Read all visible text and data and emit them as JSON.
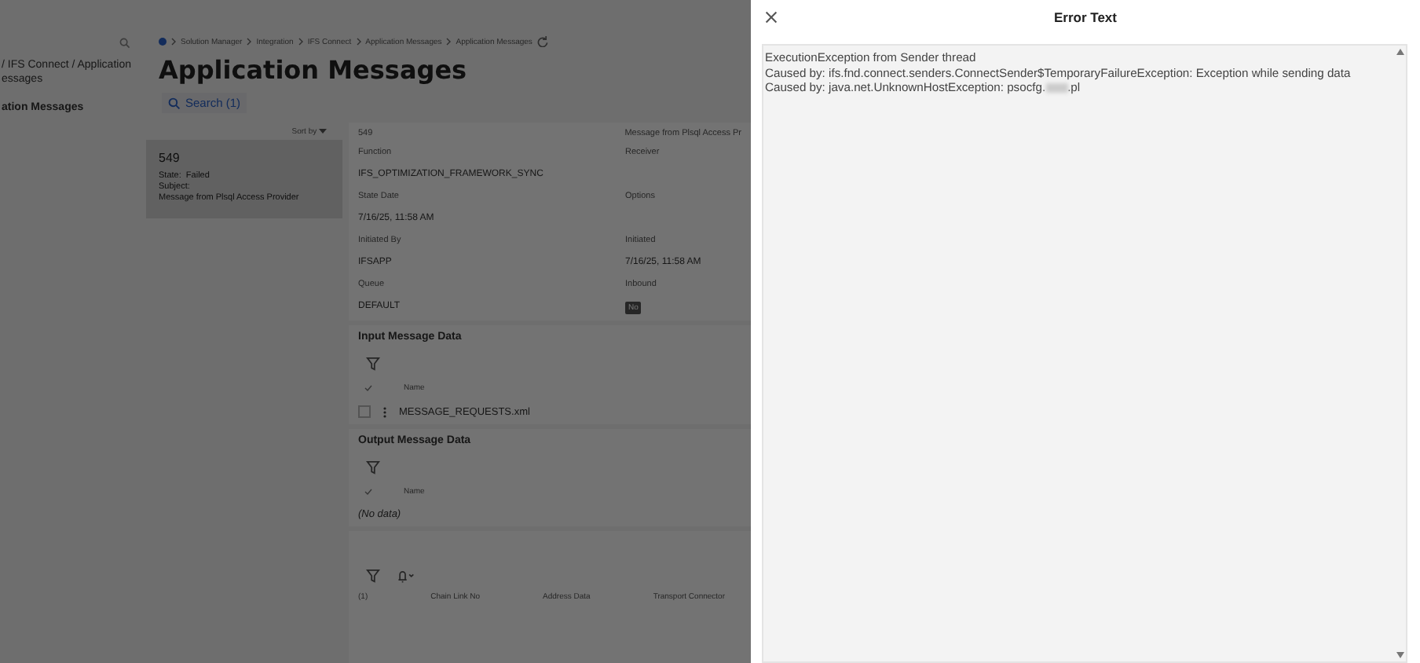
{
  "sidebar": {
    "path": "/ IFS Connect / Application\nessages",
    "current": "ation Messages"
  },
  "breadcrumb": [
    "Solution Manager",
    "Integration",
    "IFS Connect",
    "Application Messages",
    "Application Messages"
  ],
  "page_title": "Application Messages",
  "search_button": "Search (1)",
  "list": {
    "sort_label": "Sort by",
    "cards": [
      {
        "id": "549",
        "state_label": "State:",
        "state": "Failed",
        "subject_label": "Subject:",
        "subject": "Message from Plsql Access Provider",
        "selected": true
      }
    ]
  },
  "details": {
    "header_id": "549",
    "header_subject": "Message from Plsql Access Pr",
    "fields": [
      {
        "label": "Function",
        "value": "IFS_OPTIMIZATION_FRAMEWORK_SYNC"
      },
      {
        "label": "Receiver"
      },
      {
        "label": "State Date",
        "value": "7/16/25, 11:58 AM"
      },
      {
        "label": "Options"
      },
      {
        "label": "Initiated By",
        "value": "IFSAPP"
      },
      {
        "label": "Initiated",
        "value": "7/16/25, 11:58 AM"
      },
      {
        "label": "Queue",
        "value": "DEFAULT"
      },
      {
        "label": "Inbound",
        "value": "No",
        "kind": "badge"
      }
    ]
  },
  "input_data": {
    "title": "Input Message Data",
    "column": "Name",
    "rows": [
      {
        "name": "MESSAGE_REQUESTS.xml",
        "checked": false
      }
    ]
  },
  "output_data": {
    "title": "Output Message Data",
    "column": "Name",
    "empty": "(No data)"
  },
  "bottom_table": {
    "count": "(1)",
    "columns": [
      "Chain Link No",
      "Address Data",
      "Transport Connector"
    ]
  },
  "dialog": {
    "title": "Error Text",
    "lines": [
      {
        "text": "ExecutionException from Sender thread"
      },
      {
        "text": "Caused by: ifs.fnd.connect.senders.ConnectSender$TemporaryFailureException: Exception while sending data"
      },
      {
        "text": "Caused by: java.net.UnknownHostException: psocfg.",
        "redacted": true,
        "after": ".pl"
      }
    ]
  }
}
